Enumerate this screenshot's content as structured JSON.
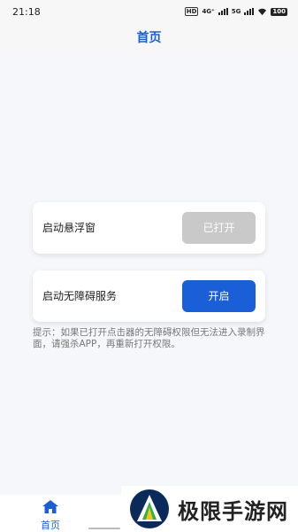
{
  "status_bar": {
    "time": "21:18",
    "hd": "HD",
    "net": "4G⁺",
    "net2": "5G",
    "battery": "100"
  },
  "header": {
    "title": "首页"
  },
  "cards": [
    {
      "label": "启动悬浮窗",
      "button": "已打开",
      "button_state": "disabled"
    },
    {
      "label": "启动无障碍服务",
      "button": "开启",
      "button_state": "primary"
    }
  ],
  "hint": "提示：如果已打开点击器的无障碍权限但无法进入录制界面，请强杀APP，再重新打开权限。",
  "bottom_nav": {
    "home_label": "首页",
    "home_icon": "home-icon"
  },
  "watermark": {
    "text": "极限手游网"
  },
  "colors": {
    "accent": "#1a5ed6",
    "primary_button": "#1a5fd8",
    "disabled_button": "#c9c9c9"
  }
}
